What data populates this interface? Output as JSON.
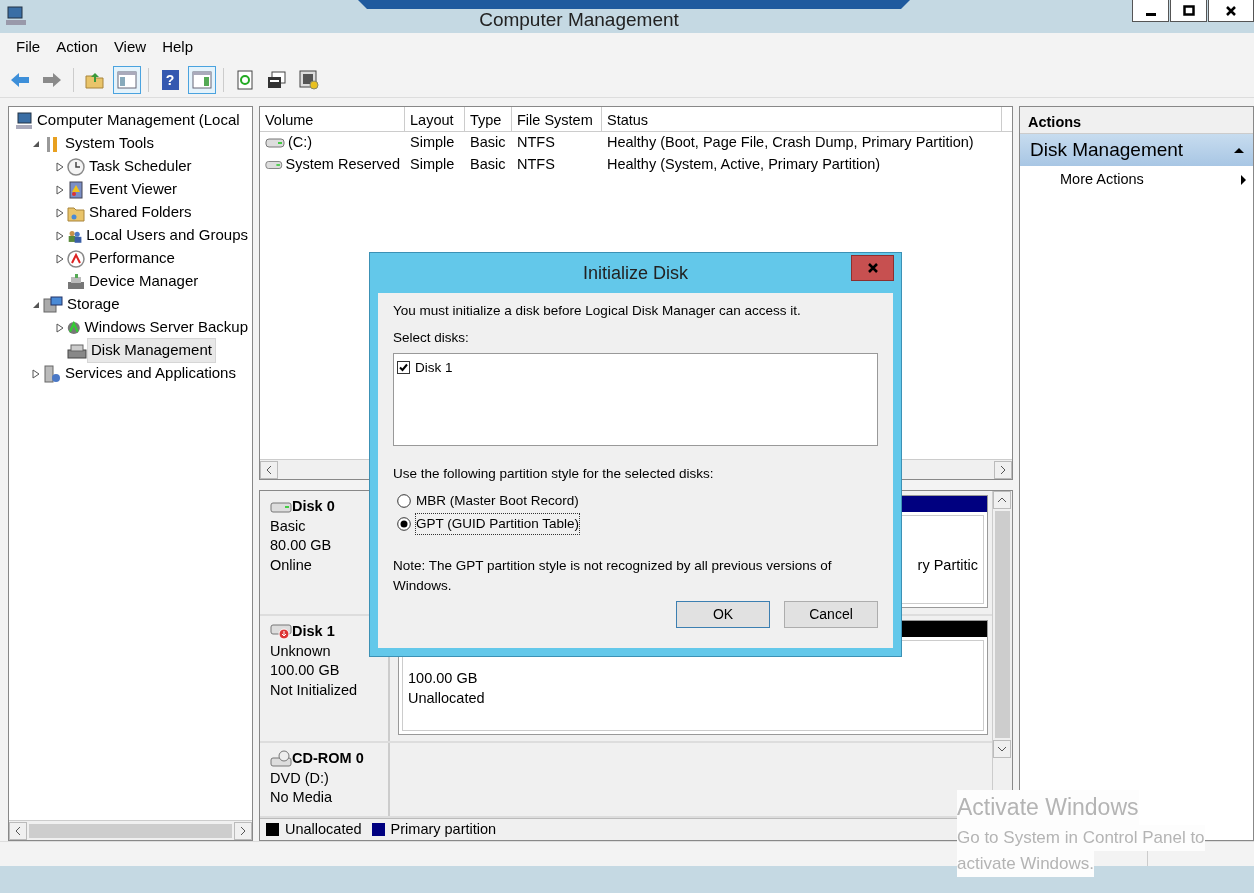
{
  "window": {
    "title": "Computer Management"
  },
  "menu": [
    "File",
    "Action",
    "View",
    "Help"
  ],
  "toolbar": [
    {
      "kind": "back",
      "pressed": false
    },
    {
      "kind": "forward",
      "pressed": false
    },
    {
      "kind": "up",
      "pressed": false
    },
    {
      "kind": "tree-pane",
      "pressed": true
    },
    {
      "kind": "help",
      "glyph": "?",
      "pressed": false
    },
    {
      "kind": "action-pane",
      "pressed": true
    },
    {
      "kind": "refresh",
      "pressed": false
    },
    {
      "kind": "properties",
      "pressed": false
    },
    {
      "kind": "settings",
      "pressed": false
    }
  ],
  "tree": [
    {
      "label": "Computer Management (Local",
      "kind": "computer",
      "selected": false,
      "children": [
        {
          "label": "System Tools",
          "kind": "tools",
          "expanded": true,
          "selected": false,
          "children": [
            {
              "label": "Task Scheduler",
              "kind": "clock",
              "expanded": false,
              "selected": false
            },
            {
              "label": "Event Viewer",
              "kind": "log",
              "expanded": false,
              "selected": false
            },
            {
              "label": "Shared Folders",
              "kind": "folder",
              "expanded": false,
              "selected": false
            },
            {
              "label": "Local Users and Groups",
              "kind": "users",
              "expanded": false,
              "selected": false
            },
            {
              "label": "Performance",
              "kind": "gauge",
              "expanded": false,
              "selected": false
            },
            {
              "label": "Device Manager",
              "kind": "device",
              "selected": false
            }
          ]
        },
        {
          "label": "Storage",
          "kind": "storage",
          "expanded": true,
          "selected": false,
          "children": [
            {
              "label": "Windows Server Backup",
              "kind": "backup",
              "expanded": false,
              "selected": false
            },
            {
              "label": "Disk Management",
              "kind": "disk",
              "selected": true
            }
          ]
        },
        {
          "label": "Services and Applications",
          "kind": "services",
          "expanded": false,
          "selected": false
        }
      ]
    }
  ],
  "volumes": {
    "columns": [
      "Volume",
      "Layout",
      "Type",
      "File System",
      "Status"
    ],
    "rows": [
      {
        "cells": [
          "(C:)",
          "Simple",
          "Basic",
          "NTFS",
          "Healthy (Boot, Page File, Crash Dump, Primary Partition)"
        ]
      },
      {
        "cells": [
          "System Reserved",
          "Simple",
          "Basic",
          "NTFS",
          "Healthy (System, Active, Primary Partition)"
        ]
      }
    ]
  },
  "disks": [
    {
      "name": "Disk 0",
      "kind": "hdd",
      "lines": [
        "Basic",
        "80.00 GB",
        "Online"
      ],
      "partitions": [
        {
          "kind": "primary",
          "lines": [
            "ry Partitic"
          ]
        }
      ]
    },
    {
      "name": "Disk 1",
      "kind": "uninitialized",
      "lines": [
        "Unknown",
        "100.00 GB",
        "Not Initialized"
      ],
      "partitions": [
        {
          "kind": "unallocated",
          "lines": [
            "100.00 GB",
            "Unallocated"
          ]
        }
      ]
    },
    {
      "name": "CD-ROM 0",
      "kind": "cdrom",
      "lines": [
        "DVD (D:)",
        "No Media"
      ]
    }
  ],
  "legend": [
    {
      "label": "Unallocated",
      "color": "#000000"
    },
    {
      "label": "Primary partition",
      "color": "#000080"
    }
  ],
  "actions": {
    "title": "Actions",
    "section": "Disk Management",
    "expanded": true,
    "items": [
      "More Actions"
    ]
  },
  "dialog": {
    "title": "Initialize Disk",
    "message": "You must initialize a disk before Logical Disk Manager can access it.",
    "select_label": "Select disks:",
    "disks": [
      {
        "label": "Disk 1",
        "checked": true
      }
    ],
    "style_label": "Use the following partition style for the selected disks:",
    "options": [
      {
        "label": "MBR (Master Boot Record)",
        "selected": false
      },
      {
        "label": "GPT (GUID Partition Table)",
        "selected": true
      }
    ],
    "note": "Note: The GPT partition style is not recognized by all previous versions of Windows.",
    "buttons": [
      {
        "label": "OK",
        "default": true
      },
      {
        "label": "Cancel",
        "default": false
      }
    ]
  },
  "activation": {
    "title": "Activate Windows",
    "lines": [
      "Go to System in Control Panel to",
      "activate Windows."
    ]
  }
}
